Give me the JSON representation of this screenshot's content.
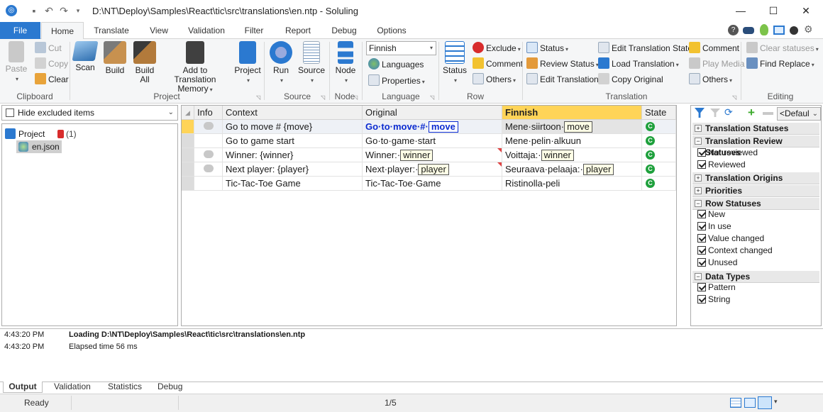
{
  "window": {
    "title": "D:\\NT\\Deploy\\Samples\\React\\tic\\src\\translations\\en.ntp  -  Soluling",
    "minimize": "—",
    "maximize": "☐",
    "close": "✕"
  },
  "tabs": [
    "File",
    "Home",
    "Translate",
    "View",
    "Validation",
    "Filter",
    "Report",
    "Debug",
    "Options"
  ],
  "ribbon": {
    "clipboard": {
      "paste": "Paste",
      "cut": "Cut",
      "copy": "Copy",
      "clear": "Clear",
      "group": "Clipboard"
    },
    "project": {
      "scan": "Scan",
      "build": "Build",
      "build_all_1": "Build",
      "build_all_2": "All",
      "add_tm_1": "Add to Translation",
      "add_tm_2": "Memory",
      "project": "Project",
      "group": "Project"
    },
    "source": {
      "run": "Run",
      "source": "Source",
      "group": "Source"
    },
    "node": {
      "node": "Node",
      "group": "Node"
    },
    "language": {
      "selected": "Finnish",
      "languages": "Languages",
      "properties": "Properties",
      "group": "Language"
    },
    "row": {
      "status": "Status",
      "exclude": "Exclude",
      "comment": "Comment",
      "others": "Others",
      "group": "Row"
    },
    "translation": {
      "status": "Status",
      "review_status": "Review Status",
      "edit_translation": "Edit Translation",
      "edit_state": "Edit Translation State",
      "load_translation": "Load Translation",
      "copy_original": "Copy Original",
      "comment": "Comment",
      "play_media": "Play Media",
      "others": "Others",
      "group": "Translation"
    },
    "editing": {
      "clear_statuses": "Clear statuses",
      "find_replace": "Find Replace",
      "group": "Editing"
    }
  },
  "left": {
    "filter": "Hide excluded items",
    "tree": {
      "project": "Project",
      "count": "(1)",
      "file": "en.json"
    }
  },
  "grid": {
    "headers": {
      "info": "Info",
      "context": "Context",
      "original": "Original",
      "finnish": "Finnish",
      "state": "State"
    },
    "rows": [
      {
        "context": "Go to move # {move}",
        "orig_text": "Go·to·move·#·",
        "orig_ph": "move",
        "trans_text": "Mene·siirtoon·",
        "trans_ph": "move",
        "state": "C"
      },
      {
        "context": "Go to game start",
        "orig_text": "Go·to·game·start",
        "orig_ph": "",
        "trans_text": "Mene·pelin·alkuun",
        "trans_ph": "",
        "state": "C"
      },
      {
        "context": "Winner: {winner}",
        "orig_text": "Winner:·",
        "orig_ph": "winner",
        "trans_text": "Voittaja:·",
        "trans_ph": "winner",
        "state": "C"
      },
      {
        "context": "Next player: {player}",
        "orig_text": "Next·player:·",
        "orig_ph": "player",
        "trans_text": "Seuraava·pelaaja:·",
        "trans_ph": "player",
        "state": "C"
      },
      {
        "context": "Tic-Tac-Toe Game",
        "orig_text": "Tic-Tac-Toe·Game",
        "orig_ph": "",
        "trans_text": "Ristinolla-peli",
        "trans_ph": "",
        "state": "C"
      }
    ]
  },
  "right": {
    "preset": "<Defaul",
    "sections": {
      "translation_statuses": "Translation Statuses",
      "review_statuses": "Translation Review Statuses",
      "origins": "Translation Origins",
      "priorities": "Priorities",
      "row_statuses": "Row Statuses",
      "data_types": "Data Types"
    },
    "review": [
      "Not reviewed",
      "Reviewed"
    ],
    "row": [
      "New",
      "In use",
      "Value changed",
      "Context changed",
      "Unused"
    ],
    "types": [
      "Pattern",
      "String"
    ]
  },
  "output": {
    "lines": [
      {
        "time": "4:43:20 PM",
        "msg": "Loading D:\\NT\\Deploy\\Samples\\React\\tic\\src\\translations\\en.ntp"
      },
      {
        "time": "4:43:20 PM",
        "msg": "Elapsed time 56 ms"
      }
    ],
    "tabs": [
      "Output",
      "Validation",
      "Statistics",
      "Debug"
    ]
  },
  "status": {
    "ready": "Ready",
    "position": "1/5"
  }
}
